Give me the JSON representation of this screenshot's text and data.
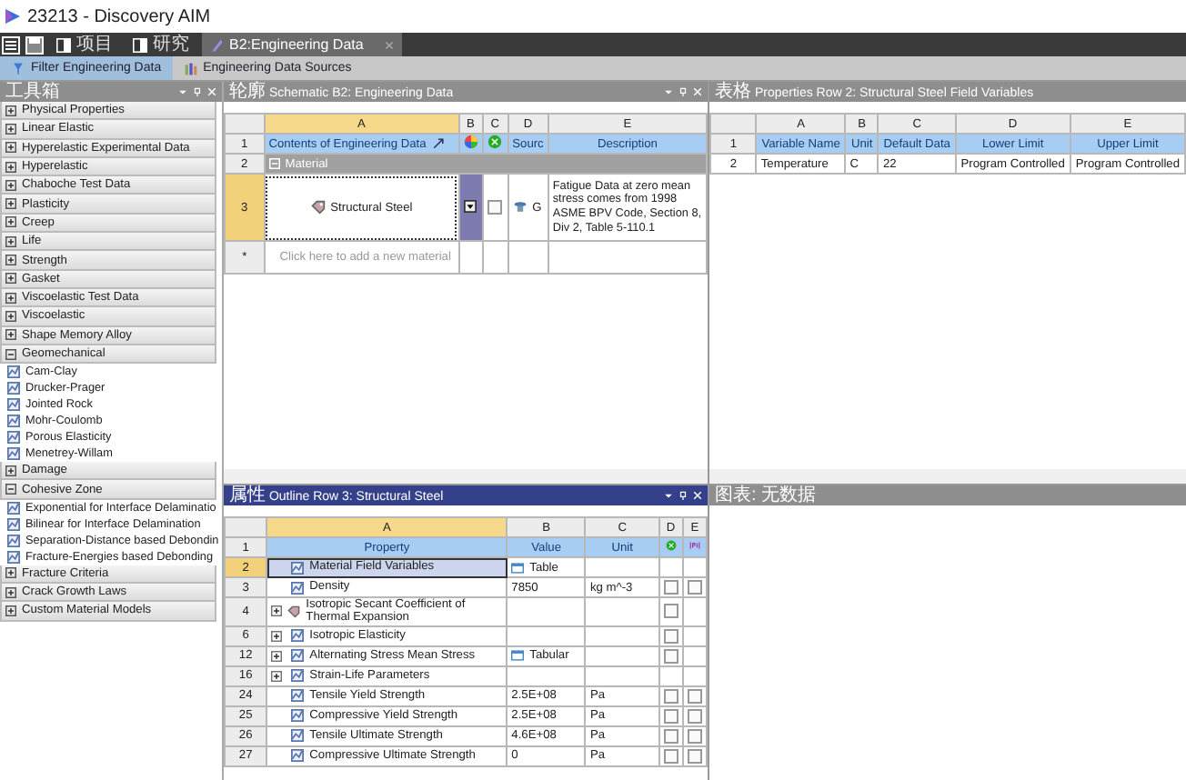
{
  "window": {
    "title": "23213 - Discovery AIM"
  },
  "tabs": [
    {
      "label": "项目",
      "selected": false,
      "kind": "page"
    },
    {
      "label": "研究",
      "selected": false,
      "kind": "page"
    },
    {
      "label": "B2:Engineering Data",
      "selected": true,
      "kind": "data"
    }
  ],
  "toolbar": [
    {
      "label": "Filter Engineering Data",
      "selected": true,
      "kind": "filter"
    },
    {
      "label": "Engineering Data Sources",
      "selected": false,
      "kind": "sources"
    }
  ],
  "toolbox": {
    "title": "工具箱",
    "categories": [
      {
        "label": "Physical Properties",
        "expanded": false
      },
      {
        "label": "Linear Elastic",
        "expanded": false
      },
      {
        "label": "Hyperelastic Experimental Data",
        "expanded": false
      },
      {
        "label": "Hyperelastic",
        "expanded": false
      },
      {
        "label": "Chaboche Test Data",
        "expanded": false
      },
      {
        "label": "Plasticity",
        "expanded": false
      },
      {
        "label": "Creep",
        "expanded": false
      },
      {
        "label": "Life",
        "expanded": false
      },
      {
        "label": "Strength",
        "expanded": false
      },
      {
        "label": "Gasket",
        "expanded": false
      },
      {
        "label": "Viscoelastic Test Data",
        "expanded": false
      },
      {
        "label": "Viscoelastic",
        "expanded": false
      },
      {
        "label": "Shape Memory Alloy",
        "expanded": false
      },
      {
        "label": "Geomechanical",
        "expanded": true,
        "children": [
          "Cam-Clay",
          "Drucker-Prager",
          "Jointed Rock",
          "Mohr-Coulomb",
          "Porous Elasticity",
          "Menetrey-Willam"
        ]
      },
      {
        "label": "Damage",
        "expanded": false
      },
      {
        "label": "Cohesive Zone",
        "expanded": true,
        "children": [
          "Exponential for Interface Delaminatio",
          "Bilinear for Interface Delamination",
          "Separation-Distance based Debondin",
          "Fracture-Energies based Debonding"
        ]
      },
      {
        "label": "Fracture Criteria",
        "expanded": false
      },
      {
        "label": "Crack Growth Laws",
        "expanded": false
      },
      {
        "label": "Custom Material Models",
        "expanded": false
      }
    ]
  },
  "schematic": {
    "prefix": "轮廓",
    "title": "Schematic B2: Engineering Data",
    "columns": [
      "A",
      "B",
      "C",
      "D",
      "E"
    ],
    "header_row": {
      "number": "1",
      "contents": "Contents of Engineering Data",
      "source": "Sourc",
      "description": "Description"
    },
    "group_row": {
      "number": "2",
      "label": "Material",
      "expanded": true
    },
    "material_row": {
      "number": "3",
      "name": "Structural Steel",
      "selected": true,
      "checked": false,
      "source": "G",
      "description": "Fatigue Data at zero mean stress comes from 1998 ASME BPV Code, Section 8, Div 2, Table 5-110.1"
    },
    "new_row": {
      "number": "*",
      "placeholder": "Click here to add a new material"
    }
  },
  "properties": {
    "prefix": "表格",
    "title": "Properties Row 2: Structural Steel Field Variables",
    "columns": [
      "A",
      "B",
      "C",
      "D",
      "E"
    ],
    "header": {
      "number": "1",
      "cells": [
        "Variable Name",
        "Unit",
        "Default Data",
        "Lower Limit",
        "Upper Limit"
      ]
    },
    "rows": [
      {
        "number": "2",
        "cells": [
          "Temperature",
          "C",
          "22",
          "Program Controlled",
          "Program Controlled"
        ]
      }
    ]
  },
  "outline": {
    "prefix": "属性",
    "title": "Outline Row 3: Structural Steel",
    "columns": [
      "A",
      "B",
      "C",
      "D",
      "E"
    ],
    "header": {
      "number": "1",
      "property": "Property",
      "value": "Value",
      "unit": "Unit"
    },
    "rows": [
      {
        "number": "2",
        "property": "Material Field Variables",
        "value": "Table",
        "kind": "table",
        "selected": true,
        "expandable": false
      },
      {
        "number": "3",
        "property": "Density",
        "value": "7850",
        "unit": "kg m^-3",
        "kind": "plain",
        "selected": false,
        "expandable": false,
        "d": {
          "checked": false
        },
        "e": {
          "checked": false
        }
      },
      {
        "number": "4",
        "property": "Isotropic Secant Coefficient of Thermal Expansion",
        "kind": "tag",
        "selected": false,
        "expandable": true,
        "d": {
          "checked": false
        }
      },
      {
        "number": "6",
        "property": "Isotropic Elasticity",
        "kind": "plain",
        "selected": false,
        "expandable": true,
        "d": {
          "checked": false
        }
      },
      {
        "number": "12",
        "property": "Alternating Stress Mean Stress",
        "value": "Tabular",
        "kind": "table",
        "selected": false,
        "expandable": true,
        "d": {
          "checked": false
        }
      },
      {
        "number": "16",
        "property": "Strain-Life Parameters",
        "kind": "plain",
        "selected": false,
        "expandable": true
      },
      {
        "number": "24",
        "property": "Tensile Yield Strength",
        "value": "2.5E+08",
        "unit": "Pa",
        "kind": "plain",
        "selected": false,
        "expandable": false,
        "d": {
          "checked": false
        },
        "e": {
          "checked": false
        }
      },
      {
        "number": "25",
        "property": "Compressive Yield Strength",
        "value": "2.5E+08",
        "unit": "Pa",
        "kind": "plain",
        "selected": false,
        "expandable": false,
        "d": {
          "checked": false
        },
        "e": {
          "checked": false
        }
      },
      {
        "number": "26",
        "property": "Tensile Ultimate Strength",
        "value": "4.6E+08",
        "unit": "Pa",
        "kind": "plain",
        "selected": false,
        "expandable": false,
        "d": {
          "checked": false
        },
        "e": {
          "checked": false
        }
      },
      {
        "number": "27",
        "property": "Compressive Ultimate Strength",
        "value": "0",
        "unit": "Pa",
        "kind": "plain",
        "selected": false,
        "expandable": false,
        "d": {
          "checked": false
        },
        "e": {
          "checked": false
        }
      }
    ]
  },
  "chart_panel": {
    "title": "图表: 无数据"
  }
}
